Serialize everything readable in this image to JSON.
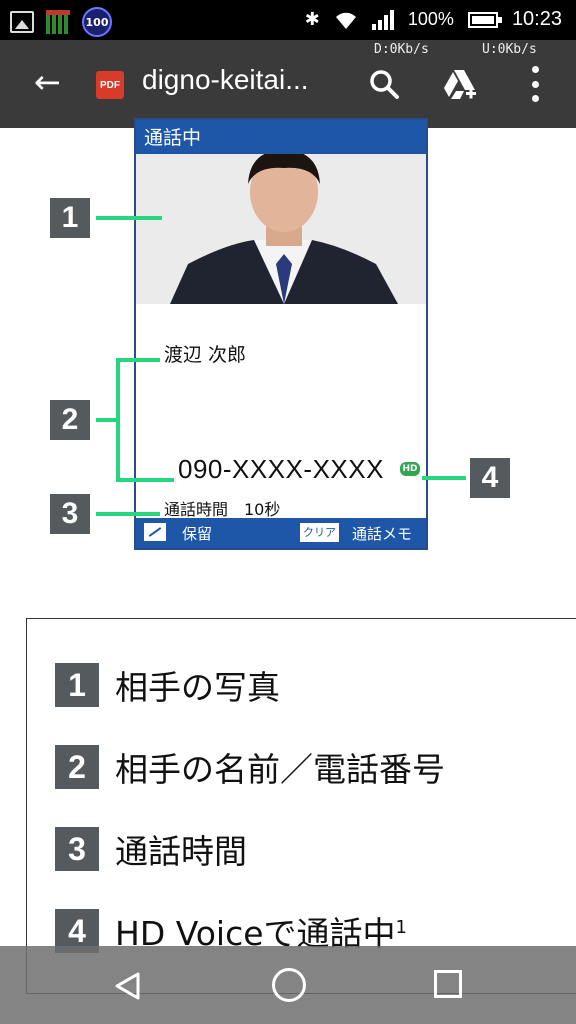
{
  "status_bar": {
    "battery_percent": "100%",
    "time": "10:23",
    "badge": "100"
  },
  "app_bar": {
    "download_speed": "D:0Kb/s",
    "upload_speed": "U:0Kb/s",
    "file_type": "PDF",
    "title": "digno-keitai...",
    "icons": [
      "back-arrow-icon",
      "pdf-icon",
      "search-icon",
      "drive-add-icon",
      "more-vert-icon"
    ]
  },
  "phone_screen": {
    "header": "通話中",
    "caller_name": "渡辺 次郎",
    "phone_number": "090-XXXX-XXXX",
    "hd_badge": "HD",
    "call_duration": "通話時間　10秒",
    "footer_hold": "保留",
    "footer_clear_key": "クリア",
    "footer_memo": "通話メモ",
    "colors": {
      "header_blue": "#1e57a8",
      "callout_green": "#27d67e",
      "callout_gray": "#555a5e"
    }
  },
  "callouts": [
    "1",
    "2",
    "3",
    "4"
  ],
  "legend": [
    {
      "num": "1",
      "text": "相手の写真"
    },
    {
      "num": "2",
      "text": "相手の名前／電話番号"
    },
    {
      "num": "3",
      "text": "通話時間"
    },
    {
      "num": "4",
      "text": "HD Voiceで通話中",
      "sup": "1"
    }
  ],
  "nav_bar": {
    "icons": [
      "nav-back-icon",
      "nav-home-icon",
      "nav-recents-icon"
    ]
  }
}
